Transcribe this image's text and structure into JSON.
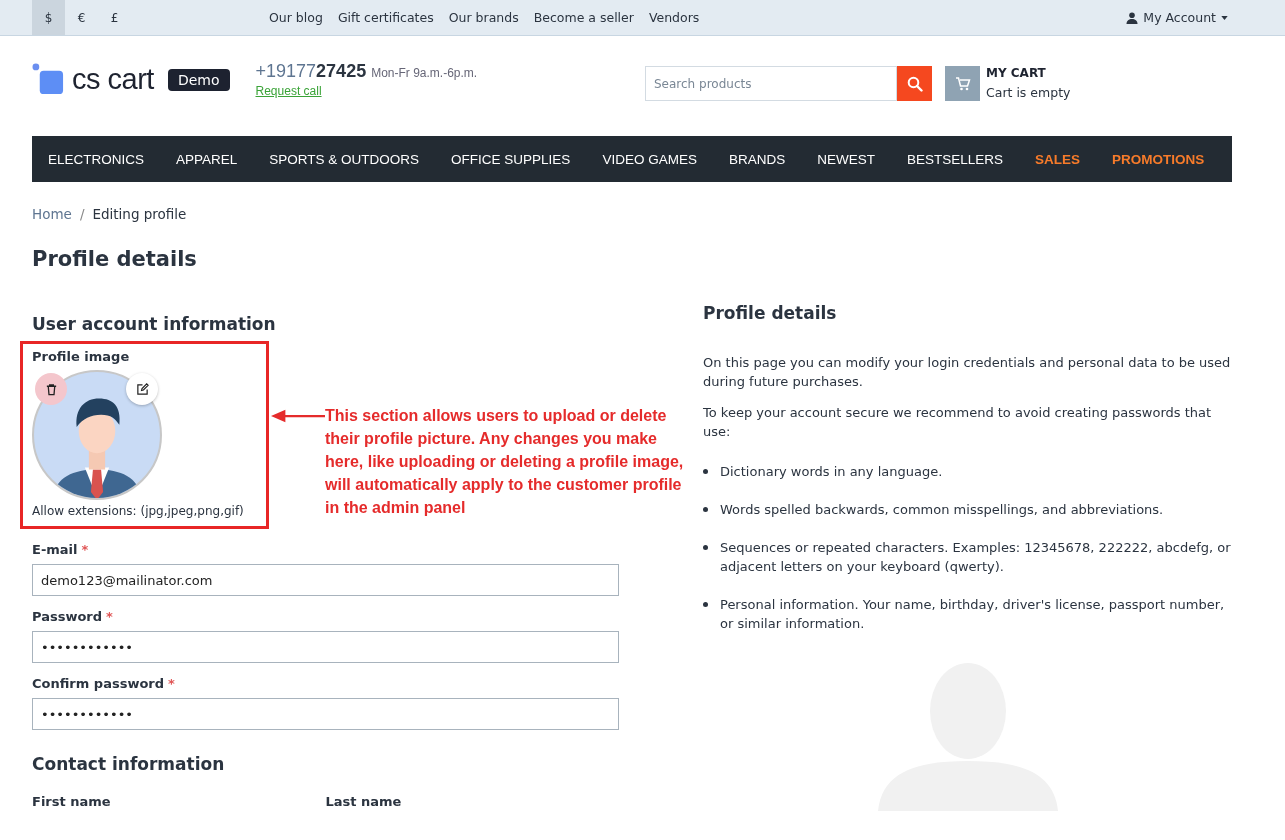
{
  "top_bar": {
    "currencies": [
      {
        "label": "$",
        "selected": true
      },
      {
        "label": "€",
        "selected": false
      },
      {
        "label": "£",
        "selected": false
      }
    ],
    "links": [
      "Our blog",
      "Gift certificates",
      "Our brands",
      "Become a seller",
      "Vendors"
    ],
    "account": "My Account"
  },
  "header": {
    "logo": "cs cart",
    "badge": "Demo",
    "phone": "+19177**27425**",
    "hours": "Mon-Fr 9a.m.-6p.m.",
    "request_call": "Request call",
    "search_placeholder": "Search products",
    "cart_title": "MY CART",
    "cart_status": "Cart is empty"
  },
  "nav": [
    {
      "label": "ELECTRONICS",
      "highlighted": false
    },
    {
      "label": "APPAREL",
      "highlighted": false
    },
    {
      "label": "SPORTS & OUTDOORS",
      "highlighted": false
    },
    {
      "label": "OFFICE SUPPLIES",
      "highlighted": false
    },
    {
      "label": "VIDEO GAMES",
      "highlighted": false
    },
    {
      "label": "BRANDS",
      "highlighted": false
    },
    {
      "label": "NEWEST",
      "highlighted": false
    },
    {
      "label": "BESTSELLERS",
      "highlighted": false
    },
    {
      "label": "SALES",
      "highlighted": true
    },
    {
      "label": "PROMOTIONS",
      "highlighted": true
    }
  ],
  "breadcrumbs": [
    "Home",
    "Editing profile"
  ],
  "breadcrumb_separator": "/",
  "page_title": "Profile details",
  "form": {
    "section_title": "User account information",
    "profile_image": {
      "label": "Profile image",
      "hint": "Allow extensions: (jpg,jpeg,png,gif)"
    },
    "fields": [
      {
        "label": "E-mail",
        "required": true,
        "value": "demo123@mailinator.com"
      },
      {
        "label": "Password",
        "required": true,
        "value": "••••••••••••"
      },
      {
        "label": "Confirm password",
        "required": true,
        "value": "••••••••••••"
      }
    ],
    "required_mark": "*",
    "contact_title": "Contact information",
    "name_labels": [
      "First name",
      "Last name"
    ]
  },
  "sidebar": {
    "title": "Profile details",
    "paragraphs": [
      "On this page you can modify your login credentials and personal data to be used during future purchases.",
      "To keep your account secure we recommend to avoid creating passwords that use:"
    ],
    "bullets": [
      "Dictionary words in any language.",
      "Words spelled backwards, common misspellings, and abbreviations.",
      "Sequences or repeated characters. Examples: 12345678, 222222, abcdefg, or adjacent letters on your keyboard (qwerty).",
      "Personal information. Your name, birthday, driver's license, passport number, or similar information."
    ]
  },
  "annotation": "This section allows users to upload or delete their profile picture. Any changes you make here, like uploading or deleting a profile image, will automatically apply to the customer profile in the admin panel"
}
